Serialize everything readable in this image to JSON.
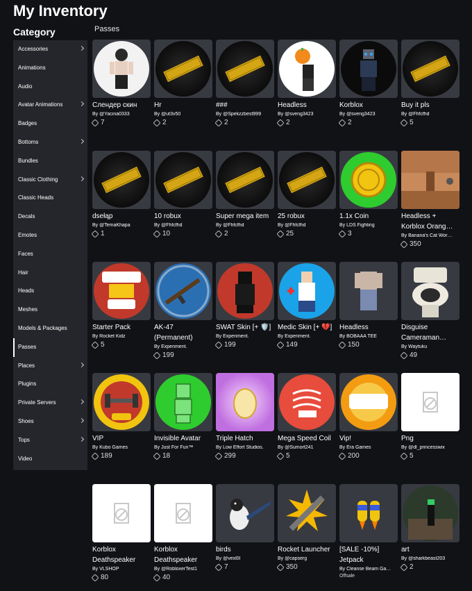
{
  "page": {
    "title": "My Inventory",
    "category_heading": "Category",
    "section_label": "Passes"
  },
  "sidebar": {
    "items": [
      {
        "label": "Accessories",
        "chevron": true
      },
      {
        "label": "Animations",
        "chevron": false
      },
      {
        "label": "Audio",
        "chevron": false
      },
      {
        "label": "Avatar Animations",
        "chevron": true
      },
      {
        "label": "Badges",
        "chevron": false
      },
      {
        "label": "Bottoms",
        "chevron": true
      },
      {
        "label": "Bundles",
        "chevron": false
      },
      {
        "label": "Classic Clothing",
        "chevron": true
      },
      {
        "label": "Classic Heads",
        "chevron": false
      },
      {
        "label": "Decals",
        "chevron": false
      },
      {
        "label": "Emotes",
        "chevron": false
      },
      {
        "label": "Faces",
        "chevron": false
      },
      {
        "label": "Hair",
        "chevron": false
      },
      {
        "label": "Heads",
        "chevron": false
      },
      {
        "label": "Meshes",
        "chevron": false
      },
      {
        "label": "Models & Packages",
        "chevron": false
      },
      {
        "label": "Passes",
        "chevron": false,
        "active": true
      },
      {
        "label": "Places",
        "chevron": true
      },
      {
        "label": "Plugins",
        "chevron": false
      },
      {
        "label": "Private Servers",
        "chevron": true
      },
      {
        "label": "Shoes",
        "chevron": true
      },
      {
        "label": "Tops",
        "chevron": true
      },
      {
        "label": "Video",
        "chevron": false
      }
    ]
  },
  "items": [
    {
      "name": "Слендер скин",
      "by": "By",
      "creator": "@Yacina0333",
      "count": "7",
      "thumb": "avatar-dark-icon"
    },
    {
      "name": "Hr",
      "by": "By",
      "creator": "@ut3v50",
      "count": "2",
      "thumb": "ticket-icon"
    },
    {
      "name": "###",
      "by": "By",
      "creator": "@Spekzzbest999",
      "count": "2",
      "thumb": "ticket-icon"
    },
    {
      "name": "Headless",
      "by": "By",
      "creator": "@sveng3423",
      "count": "2",
      "thumb": "pumpkin-avatar-icon"
    },
    {
      "name": "Korblox",
      "by": "By",
      "creator": "@sveng3423",
      "count": "2",
      "thumb": "korblox-avatar-icon"
    },
    {
      "name": "Buy it pls",
      "by": "By",
      "creator": "@Fhfcfhd",
      "count": "5",
      "thumb": "ticket-icon"
    },
    {
      "name": "dsełąp",
      "by": "By",
      "creator": "@TemaKhapa",
      "count": "1",
      "thumb": "ticket-icon"
    },
    {
      "name": "10 robux",
      "by": "By",
      "creator": "@Fhfcfhd",
      "count": "10",
      "thumb": "ticket-icon"
    },
    {
      "name": "Super mega item",
      "by": "By",
      "creator": "@Fhfcfhd",
      "count": "2",
      "thumb": "ticket-icon",
      "two": true
    },
    {
      "name": "25 robux",
      "by": "By",
      "creator": "@Fhfcfhd",
      "count": "25",
      "thumb": "ticket-icon"
    },
    {
      "name": "1.1x Coin",
      "by": "By",
      "creator": "LDS Fighting",
      "count": "3",
      "thumb": "coin-icon"
    },
    {
      "name": "Headless + Korblox Orang…",
      "by": "By",
      "creator": "Banana's Cat Wor…",
      "count": "350",
      "thumb": "crate-icon",
      "two": true
    },
    {
      "name": "Starter Pack",
      "by": "By",
      "creator": "Rocket Kidz",
      "count": "5",
      "thumb": "starter-pack-icon"
    },
    {
      "name": "AK-47 (Permanent)",
      "by": "By",
      "creator": "Experiment.",
      "count": "199",
      "thumb": "ak47-icon",
      "two": true
    },
    {
      "name": "SWAT Skin [+ 🛡️]",
      "by": "By",
      "creator": "Experiment.",
      "count": "199",
      "thumb": "swat-icon"
    },
    {
      "name": "Medic Skin [+ 💔]",
      "by": "By",
      "creator": "Experiment.",
      "count": "149",
      "thumb": "medic-icon",
      "two": true
    },
    {
      "name": "Headless",
      "by": "By",
      "creator": "BOBAAA TEE",
      "count": "150",
      "thumb": "headless-body-icon"
    },
    {
      "name": "Disguise Cameraman…",
      "by": "By",
      "creator": "Waytuku",
      "count": "49",
      "thumb": "toilet-icon",
      "two": true
    },
    {
      "name": "VIP",
      "by": "By",
      "creator": "Kubo Games",
      "count": "189",
      "thumb": "vip-dumbbell-icon"
    },
    {
      "name": "Invisible Avatar",
      "by": "By",
      "creator": "Just For Fun™",
      "count": "18",
      "thumb": "invisible-avatar-icon"
    },
    {
      "name": "Triple Hatch",
      "by": "By",
      "creator": "Low Effort Studios.",
      "count": "299",
      "thumb": "egg-icon"
    },
    {
      "name": "Mega Speed Coil",
      "by": "By",
      "creator": "@Sumort241",
      "count": "5",
      "thumb": "speed-coil-icon",
      "two": true
    },
    {
      "name": "Vip!",
      "by": "By",
      "creator": "Era Games",
      "count": "200",
      "thumb": "vip-badge-icon"
    },
    {
      "name": "Png",
      "by": "By",
      "creator": "@dl_princesswix",
      "count": "5",
      "thumb": "broken-image-icon"
    },
    {
      "name": "Korblox Deathspeaker",
      "by": "By",
      "creator": "VLSHOP",
      "count": "80",
      "thumb": "broken-image-icon",
      "two": true
    },
    {
      "name": "Korblox Deathspeaker",
      "by": "By",
      "creator": "@RobloxerTest1",
      "count": "40",
      "thumb": "broken-image-icon",
      "two": true
    },
    {
      "name": "birds",
      "by": "By",
      "creator": "@vexl0l",
      "count": "7",
      "thumb": "bird-icon"
    },
    {
      "name": "Rocket Launcher",
      "by": "By",
      "creator": "@capsеrg",
      "count": "350",
      "thumb": "rocket-launcher-icon",
      "two": true
    },
    {
      "name": "[SALE -10%] Jetpack",
      "by": "By",
      "creator": "Cleanse Beam Ga…",
      "offsale": "Offsale",
      "thumb": "jetpack-icon",
      "two": true
    },
    {
      "name": "art",
      "by": "By",
      "creator": "@sharkbeast203",
      "count": "2",
      "thumb": "art-scene-icon"
    }
  ],
  "colors": {
    "background": "#111216",
    "sidebar": "#24262b",
    "tile": "#383a41"
  }
}
